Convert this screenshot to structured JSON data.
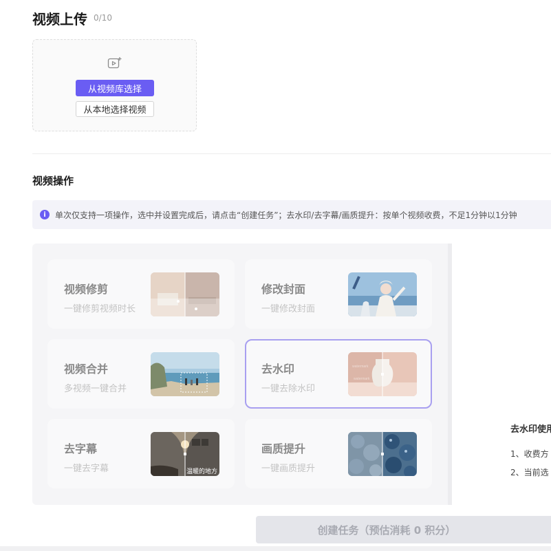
{
  "upload": {
    "title": "视频上传",
    "counter": "0/10",
    "library_button": "从视频库选择",
    "local_button": "从本地选择视频",
    "icon": "video-add-icon"
  },
  "operations": {
    "title": "视频操作",
    "notice": "单次仅支持一项操作，选中并设置完成后，请点击“创建任务”；去水印/去字幕/画质提升：按单个视频收费，不足1分钟以1分钟",
    "info_icon": "info-icon",
    "cards": [
      {
        "title": "视频修剪",
        "subtitle": "一键修剪视频时长",
        "selected": false
      },
      {
        "title": "修改封面",
        "subtitle": "一键修改封面",
        "selected": false
      },
      {
        "title": "视频合并",
        "subtitle": "多视频一键合并",
        "selected": false
      },
      {
        "title": "去水印",
        "subtitle": "一键去除水印",
        "selected": true
      },
      {
        "title": "去字幕",
        "subtitle": "一键去字幕",
        "selected": false
      },
      {
        "title": "画质提升",
        "subtitle": "一键画质提升",
        "selected": false
      }
    ],
    "subtitle_thumb_caption": "温暖的地方"
  },
  "usage": {
    "title": "去水印使用",
    "line1": "1、收费方",
    "line2": "2、当前选"
  },
  "create_button": "创建任务（预估消耗 0 积分）",
  "colors": {
    "accent": "#6a5df3",
    "selected_border": "#a89ff0"
  }
}
